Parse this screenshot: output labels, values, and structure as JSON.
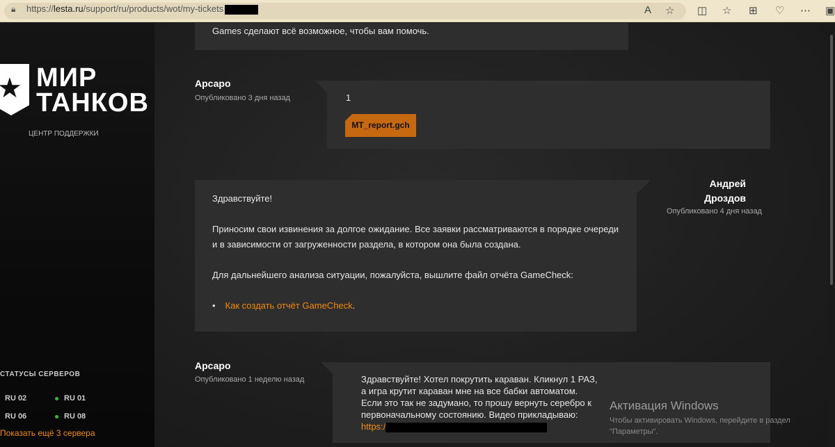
{
  "browser": {
    "url_prefix": "https://",
    "url_domain": "lesta.ru",
    "url_path": "/support/ru/products/wot/my-tickets"
  },
  "sidebar": {
    "logo_line1": "МИР",
    "logo_line2": "ТАНКОВ",
    "subtitle": "ЦЕНТР ПОДДЕРЖКИ",
    "status_title": "СТАТУСЫ СЕРВЕРОВ",
    "servers": [
      {
        "name": "RU 02",
        "online": true
      },
      {
        "name": "RU 01",
        "online": true
      },
      {
        "name": "RU 06",
        "online": true
      },
      {
        "name": "RU 08",
        "online": true
      }
    ],
    "show_more": "Показать ещё 3 сервера"
  },
  "messages": [
    {
      "text": "Games сделают всё возможное, чтобы вам помочь."
    },
    {
      "author": "Арсаро",
      "date": "Опубликовано 3 дня назад",
      "text": "1",
      "attachment": "MT_report.gch"
    },
    {
      "author_line1": "Андрей",
      "author_line2": "Дроздов",
      "date": "Опубликовано 4 дня назад",
      "greeting": "Здравствуйте!",
      "p1": "Приносим свои извинения за долгое ожидание. Все заявки рассматриваются в порядке очереди и в зависимости от загруженности раздела, в котором она была создана.",
      "p2": "Для дальнейшего анализа ситуации, пожалуйста, вышлите файл отчёта GameCheck:",
      "link": "Как создать отчёт GameCheck",
      "link_suffix": "."
    },
    {
      "author": "Арсаро",
      "date": "Опубликовано 1 неделю назад",
      "text": "Здравствуйте! Хотел покрутить караван. Кликнул 1 РАЗ, а игра крутит караван мне на все бабки автоматом. Если это так не задумано, то прошу вернуть серебро к первоначальному состоянию. Видео прикладываю:",
      "link": "https:/"
    }
  ],
  "watermark": {
    "title": "Активация Windows",
    "text": "Чтобы активировать Windows, перейдите в раздел \"Параметры\"."
  }
}
